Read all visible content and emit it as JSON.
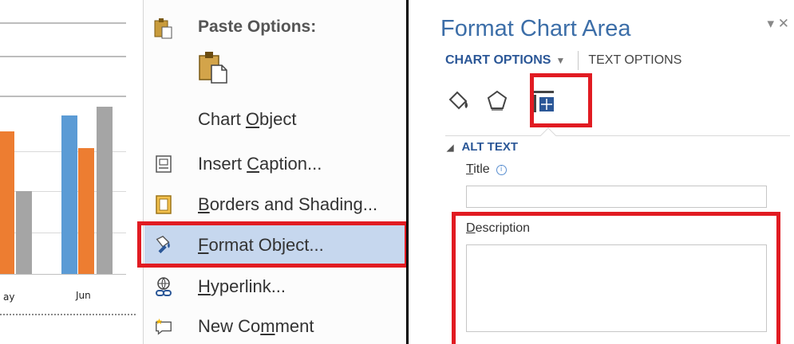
{
  "chart_fragment": {
    "x_ticks": [
      "ay",
      "Jun"
    ],
    "series_colors": [
      "#5b9bd5",
      "#ed7d31",
      "#a5a5a5"
    ]
  },
  "context_menu": {
    "paste_options_label": "Paste Options:",
    "items": [
      {
        "pre": "Chart ",
        "key": "O",
        "post": "bject",
        "icon": "none"
      },
      {
        "pre": "Insert ",
        "key": "C",
        "post": "aption...",
        "icon": "caption-icon"
      },
      {
        "pre": "",
        "key": "B",
        "post": "orders and Shading...",
        "icon": "borders-icon"
      },
      {
        "pre": "",
        "key": "F",
        "post": "ormat Object...",
        "icon": "format-object-icon",
        "highlighted": true
      },
      {
        "pre": "",
        "key": "H",
        "post": "yperlink...",
        "icon": "hyperlink-icon"
      },
      {
        "pre": "New Co",
        "key": "m",
        "post": "ment",
        "icon": "new-comment-icon"
      }
    ]
  },
  "format_pane": {
    "title": "Format Chart Area",
    "controls": "▾ ✕",
    "tabs": {
      "chart_options": "CHART OPTIONS",
      "text_options": "TEXT OPTIONS"
    },
    "icons": [
      "fill-line-icon",
      "effects-icon",
      "size-properties-icon"
    ],
    "section": {
      "heading": "ALT TEXT",
      "title_label_key": "T",
      "title_label_rest": "itle",
      "title_value": "",
      "description_label_key": "D",
      "description_label_rest": "escription",
      "description_value": ""
    }
  },
  "colors": {
    "highlight_box": "#e11b22",
    "menu_hover": "#c6d7ee",
    "pane_title": "#3c6ea8",
    "accent": "#2b5797"
  }
}
